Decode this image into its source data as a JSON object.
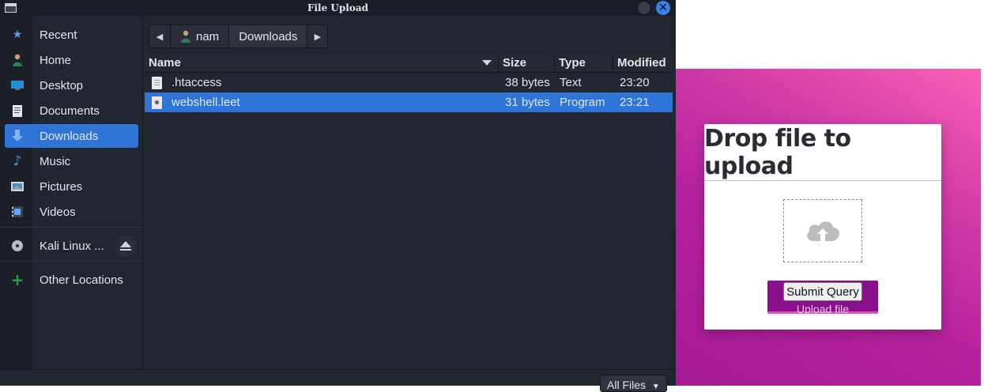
{
  "dialog": {
    "title": "File Upload",
    "sidebar": [
      {
        "label": "Recent",
        "icon": "star-icon"
      },
      {
        "label": "Home",
        "icon": "home-icon"
      },
      {
        "label": "Desktop",
        "icon": "desktop-icon"
      },
      {
        "label": "Documents",
        "icon": "documents-icon"
      },
      {
        "label": "Downloads",
        "icon": "download-icon",
        "active": true
      },
      {
        "label": "Music",
        "icon": "music-icon"
      },
      {
        "label": "Pictures",
        "icon": "pictures-icon"
      },
      {
        "label": "Videos",
        "icon": "videos-icon"
      },
      {
        "label": "Kali Linux ...",
        "icon": "disc-icon"
      },
      {
        "label": "Other Locations",
        "icon": "plus-icon"
      }
    ],
    "pathbar": {
      "segments": [
        "nam",
        "Downloads"
      ]
    },
    "columns": {
      "name": "Name",
      "size": "Size",
      "type": "Type",
      "modified": "Modified"
    },
    "files": [
      {
        "name": ".htaccess",
        "size": "38 bytes",
        "type": "Text",
        "modified": "23:20"
      },
      {
        "name": "webshell.leet",
        "size": "31 bytes",
        "type": "Program",
        "modified": "23:21",
        "selected": true
      }
    ],
    "filter": {
      "label": "All Files"
    }
  },
  "webpage": {
    "heading": "Drop file to upload",
    "submit_label": "Submit Query",
    "upload_link": "Upload file"
  },
  "colors": {
    "accent": "#2f75d8",
    "dialog_bg": "#222631",
    "gradient_start": "#fb5fb5",
    "gradient_end": "#a51b96",
    "upload_button": "#8a0f8c"
  }
}
